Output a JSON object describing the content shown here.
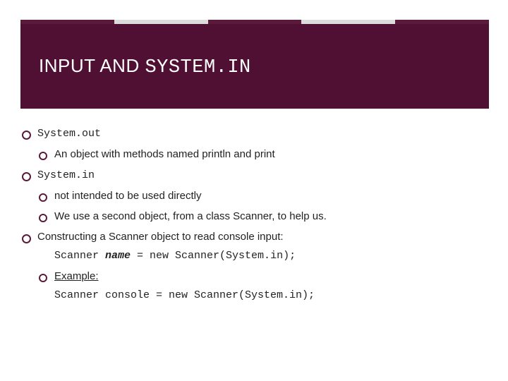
{
  "title": {
    "part1": "INPUT AND ",
    "part2": "SYSTEM.IN"
  },
  "bullets": {
    "b1": "System.out",
    "b1_1": "An object with methods named println and print",
    "b2": "System.in",
    "b2_1": "not intended to be used directly",
    "b2_2": "We use a second object, from a class Scanner, to help us.",
    "b3": "Constructing a Scanner object to read console input:",
    "b3_code_pre": "Scanner ",
    "b3_code_name": "name",
    "b3_code_post": " = new Scanner(System.in);",
    "b3_1": "Example:",
    "b3_1_code": "Scanner console = new Scanner(System.in);"
  }
}
